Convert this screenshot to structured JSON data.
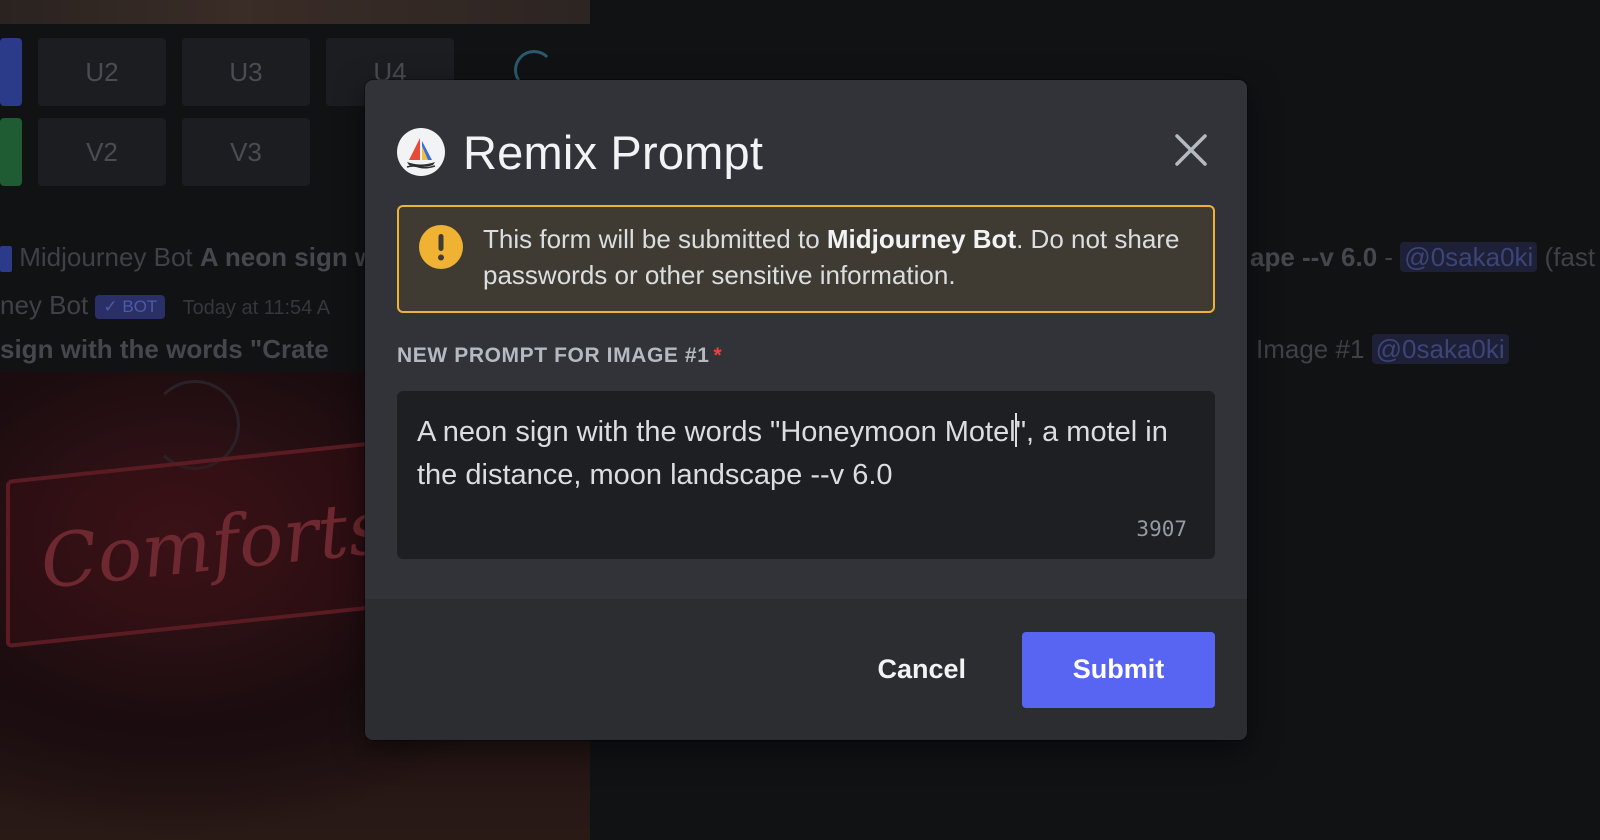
{
  "background": {
    "grid_buttons_row1": [
      "U2",
      "U3",
      "U4"
    ],
    "grid_buttons_row2": [
      "V2",
      "V3"
    ],
    "message_line1_author": "Midjourney Bot",
    "message_line1_prompt": "A neon sign w",
    "message_line1_tail": "ape --v 6.0",
    "message_line1_mention": "@0saka0ki",
    "message_line1_suffix": "(fast",
    "author_name": "ney Bot",
    "bot_badge": "✓ BOT",
    "timestamp": "Today at 11:54 A",
    "message_line3_prompt": "sign with the words \"Crate",
    "message_line3_tail": "Image #1",
    "message_line3_mention": "@0saka0ki",
    "sign_text": "Comfortss"
  },
  "modal": {
    "title": "Remix Prompt",
    "app_icon": "midjourney-sailboat-icon",
    "close_icon": "close-icon",
    "warning": {
      "icon": "exclamation-icon",
      "text_before": "This form will be submitted to ",
      "bot_name": "Midjourney Bot",
      "text_after": ". Do not share passwords or other sensitive information."
    },
    "field": {
      "label": "NEW PROMPT FOR IMAGE #1",
      "required_marker": "*",
      "value_before_caret": "A neon sign with the words \"Honeymoon Motel",
      "value_after_caret": "\", a motel in the distance, moon landscape --v 6.0",
      "char_count": "3907"
    },
    "footer": {
      "cancel_label": "Cancel",
      "submit_label": "Submit"
    }
  },
  "colors": {
    "modal_bg": "#313338",
    "footer_bg": "#2b2d31",
    "warning_border": "#f0b232",
    "submit_bg": "#5865f2",
    "required_red": "#f23f43"
  }
}
